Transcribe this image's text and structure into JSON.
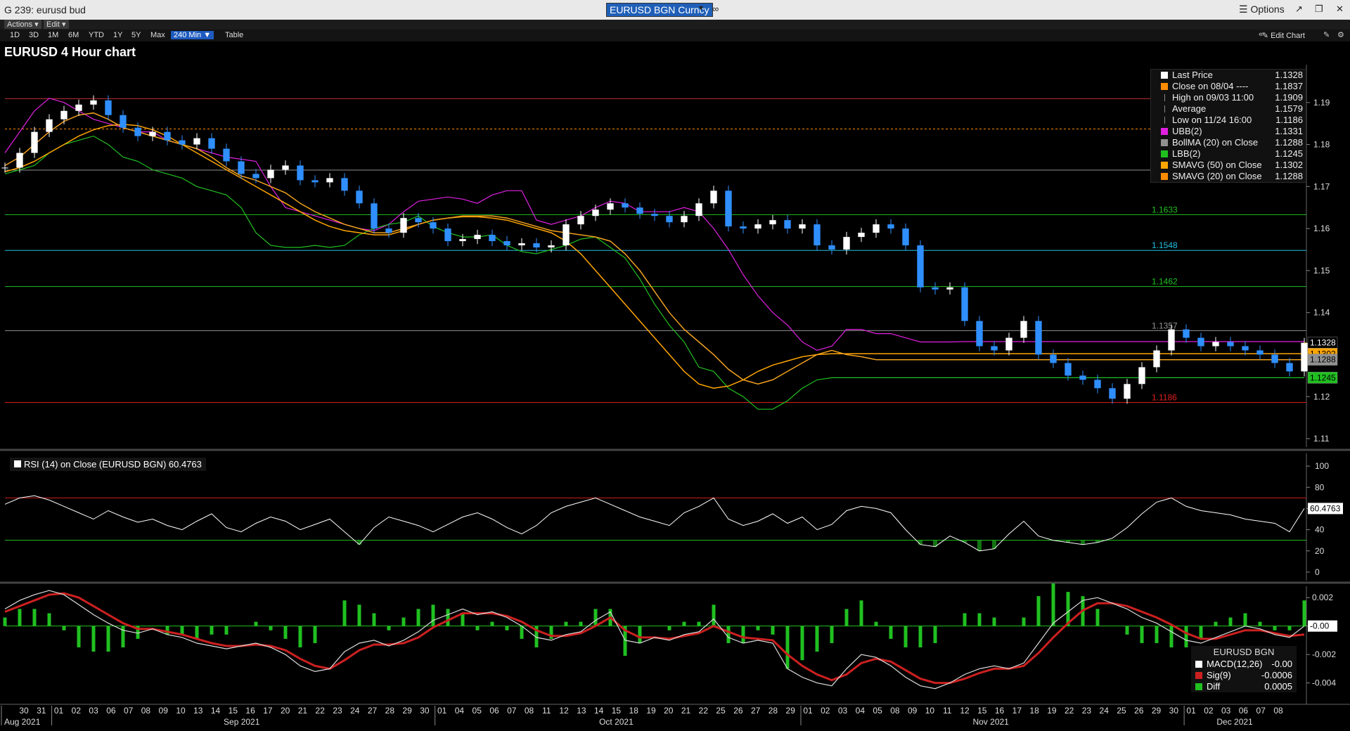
{
  "window": {
    "title": "G 239: eurusd bud",
    "ticker": "EURUSD BGN Curncy",
    "options_label": "Options"
  },
  "menu": {
    "actions": "Actions ▾",
    "edit": "Edit ▾"
  },
  "toolbar": {
    "periods": [
      "1D",
      "3D",
      "1M",
      "6M",
      "YTD",
      "1Y",
      "5Y",
      "Max"
    ],
    "interval": "240 Min ▼",
    "table": "Table",
    "edit_chart": "Edit Chart"
  },
  "chart_title": "EURUSD 4 Hour chart",
  "colors": {
    "price_up": "#ffffff",
    "price_down": "#2f8fff",
    "ubb": "#e020e0",
    "bollma": "#f0a020",
    "lbb": "#20c020",
    "sma50": "#ffa500",
    "rsi_line": "#ffffff",
    "rsi_high": "#cc2020",
    "rsi_low": "#20c020",
    "macd_hist": "#20c020",
    "sig": "#cc2020"
  },
  "legend": [
    {
      "label": "Last Price",
      "value": "1.1328",
      "color": "#ffffff"
    },
    {
      "label": "Close on 08/04 ----",
      "value": "1.1837",
      "color": "#ff8c00"
    },
    {
      "label": "High on 09/03 11:00",
      "value": "1.1909",
      "color": ""
    },
    {
      "label": "Average",
      "value": "1.1579",
      "color": ""
    },
    {
      "label": "Low on 11/24 16:00",
      "value": "1.1186",
      "color": ""
    },
    {
      "label": "UBB(2)",
      "value": "1.1331",
      "color": "#e020e0"
    },
    {
      "label": "BollMA (20)  on Close",
      "value": "1.1288",
      "color": "#909090"
    },
    {
      "label": "LBB(2)",
      "value": "1.1245",
      "color": "#20c020"
    },
    {
      "label": "SMAVG (50)  on Close",
      "value": "1.1302",
      "color": "#ffa500"
    },
    {
      "label": "SMAVG (20)  on Close",
      "value": "1.1288",
      "color": "#ff8c00"
    }
  ],
  "rsi_label": "RSI (14)  on Close (EURUSD BGN) 60.4763",
  "macd_legend": {
    "title": "EURUSD BGN",
    "rows": [
      {
        "label": "MACD(12,26)",
        "value": "-0.00",
        "color": "#ffffff"
      },
      {
        "label": "Sig(9)",
        "value": "-0.0006",
        "color": "#cc2020"
      },
      {
        "label": "Diff",
        "value": "0.0005",
        "color": "#20c020"
      }
    ]
  },
  "chart_data": {
    "type": "line",
    "price_panel": {
      "y_ticks": [
        "1.19",
        "1.18",
        "1.17",
        "1.16",
        "1.15",
        "1.14",
        "1.13",
        "1.12",
        "1.11"
      ],
      "ylim": [
        1.108,
        1.199
      ],
      "hlines": [
        {
          "value": 1.1909,
          "label": "",
          "color": "#c03030"
        },
        {
          "value": 1.1837,
          "label": "",
          "color": "#ff8c00",
          "dashed": true
        },
        {
          "value": 1.1739,
          "label": "",
          "color": "#909090"
        },
        {
          "value": 1.1633,
          "label": "1.1633",
          "color": "#20c020"
        },
        {
          "value": 1.1548,
          "label": "1.1548",
          "color": "#20c0e0"
        },
        {
          "value": 1.1462,
          "label": "1.1462",
          "color": "#20c020"
        },
        {
          "value": 1.1357,
          "label": "1.1357",
          "color": "#909090"
        },
        {
          "value": 1.1186,
          "label": "1.1186",
          "color": "#e02020"
        }
      ],
      "tags": [
        {
          "value": 1.1328,
          "text": "1.1328",
          "bg": "#000000",
          "fg": "#ffffff"
        },
        {
          "value": 1.1302,
          "text": "1.1302",
          "bg": "#ffa500",
          "fg": "#000000"
        },
        {
          "value": 1.1288,
          "text": "1.1288",
          "bg": "#909090",
          "fg": "#000000"
        },
        {
          "value": 1.1245,
          "text": "1.1245",
          "bg": "#20c020",
          "fg": "#000000"
        }
      ],
      "close": [
        1.1745,
        1.178,
        1.183,
        1.186,
        1.188,
        1.1895,
        1.1905,
        1.187,
        1.184,
        1.182,
        1.183,
        1.181,
        1.18,
        1.1815,
        1.179,
        1.176,
        1.173,
        1.172,
        1.174,
        1.175,
        1.1715,
        1.171,
        1.172,
        1.169,
        1.166,
        1.16,
        1.159,
        1.1625,
        1.1615,
        1.16,
        1.157,
        1.1575,
        1.1585,
        1.157,
        1.156,
        1.1565,
        1.1555,
        1.156,
        1.161,
        1.163,
        1.1645,
        1.166,
        1.165,
        1.1635,
        1.163,
        1.1615,
        1.163,
        1.166,
        1.169,
        1.1605,
        1.16,
        1.161,
        1.162,
        1.16,
        1.161,
        1.156,
        1.155,
        1.158,
        1.159,
        1.161,
        1.16,
        1.156,
        1.146,
        1.1455,
        1.146,
        1.138,
        1.132,
        1.131,
        1.134,
        1.138,
        1.13,
        1.128,
        1.125,
        1.124,
        1.122,
        1.1195,
        1.123,
        1.127,
        1.131,
        1.136,
        1.134,
        1.132,
        1.133,
        1.132,
        1.131,
        1.13,
        1.128,
        1.126,
        1.1328
      ],
      "ubb": [
        1.178,
        1.183,
        1.188,
        1.191,
        1.19,
        1.188,
        1.186,
        1.185,
        1.184,
        1.183,
        1.183,
        1.181,
        1.18,
        1.179,
        1.178,
        1.177,
        1.1765,
        1.176,
        1.17,
        1.165,
        1.164,
        1.163,
        1.162,
        1.161,
        1.16,
        1.1595,
        1.161,
        1.164,
        1.1665,
        1.167,
        1.1675,
        1.167,
        1.166,
        1.168,
        1.169,
        1.169,
        1.162,
        1.161,
        1.162,
        1.163,
        1.165,
        1.1665,
        1.166,
        1.164,
        1.164,
        1.164,
        1.165,
        1.164,
        1.16,
        1.155,
        1.149,
        1.144,
        1.14,
        1.137,
        1.133,
        1.131,
        1.132,
        1.136,
        1.136,
        1.135,
        1.135,
        1.134,
        1.133,
        1.133,
        1.133,
        1.1331,
        1.1331,
        1.1331,
        1.1331,
        1.1331,
        1.1331,
        1.1331,
        1.1331,
        1.1331,
        1.1331,
        1.1331,
        1.1331,
        1.1331,
        1.1331,
        1.1331,
        1.1331,
        1.1331,
        1.1331,
        1.1331,
        1.1331,
        1.1331,
        1.1331,
        1.1331,
        1.1331
      ],
      "lbb": [
        1.173,
        1.174,
        1.175,
        1.178,
        1.18,
        1.181,
        1.182,
        1.18,
        1.177,
        1.176,
        1.174,
        1.173,
        1.172,
        1.17,
        1.169,
        1.168,
        1.165,
        1.159,
        1.156,
        1.1555,
        1.1555,
        1.156,
        1.1555,
        1.156,
        1.1585,
        1.16,
        1.161,
        1.1615,
        1.163,
        1.1605,
        1.159,
        1.158,
        1.158,
        1.1585,
        1.156,
        1.1545,
        1.154,
        1.155,
        1.156,
        1.1575,
        1.158,
        1.1555,
        1.153,
        1.148,
        1.142,
        1.137,
        1.133,
        1.127,
        1.126,
        1.122,
        1.12,
        1.117,
        1.117,
        1.119,
        1.122,
        1.124,
        1.1245,
        1.1245,
        1.1245,
        1.1245,
        1.1245,
        1.1245,
        1.1245,
        1.1245,
        1.1245,
        1.1245,
        1.1245,
        1.1245,
        1.1245,
        1.1245,
        1.1245,
        1.1245,
        1.1245,
        1.1245,
        1.1245,
        1.1245,
        1.1245,
        1.1245,
        1.1245,
        1.1245,
        1.1245,
        1.1245,
        1.1245,
        1.1245,
        1.1245,
        1.1245,
        1.1245,
        1.1245,
        1.1245
      ],
      "sma20": [
        1.175,
        1.177,
        1.18,
        1.183,
        1.1855,
        1.187,
        1.1875,
        1.186,
        1.184,
        1.183,
        1.182,
        1.181,
        1.18,
        1.179,
        1.177,
        1.1745,
        1.1725,
        1.1715,
        1.17,
        1.1685,
        1.166,
        1.164,
        1.1625,
        1.161,
        1.16,
        1.159,
        1.159,
        1.16,
        1.161,
        1.162,
        1.1625,
        1.163,
        1.163,
        1.163,
        1.1625,
        1.1615,
        1.1605,
        1.1595,
        1.159,
        1.1585,
        1.158,
        1.157,
        1.154,
        1.15,
        1.145,
        1.14,
        1.136,
        1.133,
        1.13,
        1.1265,
        1.124,
        1.123,
        1.124,
        1.126,
        1.128,
        1.13,
        1.131,
        1.13,
        1.1295,
        1.1288,
        1.1288,
        1.1288,
        1.1288,
        1.1288,
        1.1288,
        1.1288,
        1.1288,
        1.1288,
        1.1288,
        1.1288,
        1.1288,
        1.1288,
        1.1288,
        1.1288,
        1.1288,
        1.1288,
        1.1288,
        1.1288,
        1.1288,
        1.1288,
        1.1288,
        1.1288,
        1.1288,
        1.1288,
        1.1288,
        1.1288,
        1.1288,
        1.1288,
        1.1288
      ],
      "sma50": [
        1.1735,
        1.1745,
        1.176,
        1.178,
        1.18,
        1.182,
        1.1835,
        1.1845,
        1.1848,
        1.1845,
        1.1835,
        1.182,
        1.18,
        1.178,
        1.176,
        1.174,
        1.172,
        1.17,
        1.168,
        1.166,
        1.164,
        1.162,
        1.1605,
        1.1595,
        1.159,
        1.1585,
        1.1585,
        1.1595,
        1.161,
        1.162,
        1.1625,
        1.1628,
        1.1628,
        1.1625,
        1.162,
        1.161,
        1.16,
        1.159,
        1.157,
        1.154,
        1.15,
        1.146,
        1.142,
        1.138,
        1.134,
        1.13,
        1.126,
        1.123,
        1.122,
        1.1225,
        1.124,
        1.126,
        1.1275,
        1.1285,
        1.1295,
        1.13,
        1.1302,
        1.1302,
        1.1302,
        1.1302,
        1.1302,
        1.1302,
        1.1302,
        1.1302,
        1.1302,
        1.1302,
        1.1302,
        1.1302,
        1.1302,
        1.1302,
        1.1302,
        1.1302,
        1.1302,
        1.1302,
        1.1302,
        1.1302,
        1.1302,
        1.1302,
        1.1302,
        1.1302,
        1.1302,
        1.1302,
        1.1302,
        1.1302,
        1.1302,
        1.1302,
        1.1302,
        1.1302,
        1.1302
      ]
    },
    "rsi_panel": {
      "name": "RSI (14)",
      "y_ticks": [
        "100",
        "80",
        "60",
        "40",
        "20",
        "0"
      ],
      "ylim": [
        -8,
        112
      ],
      "levels": [
        70,
        30
      ],
      "last": "60.4763",
      "values": [
        64,
        70,
        72,
        68,
        62,
        56,
        50,
        58,
        52,
        47,
        50,
        44,
        40,
        48,
        55,
        42,
        38,
        46,
        52,
        48,
        40,
        45,
        50,
        38,
        26,
        42,
        52,
        48,
        44,
        38,
        45,
        52,
        56,
        50,
        42,
        36,
        44,
        56,
        62,
        66,
        70,
        64,
        58,
        52,
        48,
        44,
        56,
        62,
        70,
        50,
        44,
        48,
        55,
        46,
        52,
        40,
        45,
        58,
        62,
        60,
        56,
        40,
        26,
        24,
        34,
        28,
        20,
        22,
        36,
        48,
        34,
        30,
        28,
        26,
        28,
        32,
        42,
        55,
        66,
        70,
        62,
        58,
        56,
        54,
        50,
        48,
        46,
        38,
        60
      ]
    },
    "macd_panel": {
      "y_ticks": [
        "0.002",
        "0.000",
        "-0.002",
        "-0.004"
      ],
      "ylim": [
        -0.0055,
        0.0028
      ],
      "current_tag": "-0.00",
      "macd": [
        0.0012,
        0.0018,
        0.0022,
        0.0025,
        0.0022,
        0.0015,
        0.0008,
        0.0002,
        -0.0003,
        -0.0005,
        -0.0002,
        -0.0006,
        -0.0008,
        -0.0012,
        -0.0014,
        -0.0016,
        -0.0014,
        -0.0012,
        -0.0015,
        -0.002,
        -0.0028,
        -0.0032,
        -0.003,
        -0.0018,
        -0.0012,
        -0.001,
        -0.0014,
        -0.001,
        -0.0004,
        0.0004,
        0.0008,
        0.0012,
        0.0008,
        0.001,
        0.0006,
        0.0,
        -0.0008,
        -0.001,
        -0.0006,
        -0.0004,
        0.0004,
        0.001,
        -0.001,
        -0.0012,
        -0.0008,
        -0.001,
        -0.0006,
        -0.0004,
        0.0005,
        -0.0008,
        -0.0012,
        -0.001,
        -0.0012,
        -0.003,
        -0.0036,
        -0.004,
        -0.0042,
        -0.003,
        -0.002,
        -0.0022,
        -0.0028,
        -0.0036,
        -0.0042,
        -0.0044,
        -0.004,
        -0.0034,
        -0.003,
        -0.0028,
        -0.003,
        -0.0026,
        -0.0012,
        0.0002,
        0.001,
        0.0018,
        0.002,
        0.0016,
        0.0012,
        0.0006,
        0.0002,
        -0.0004,
        -0.001,
        -0.0012,
        -0.0008,
        -0.0004,
        0.0,
        -0.0002,
        -0.0006,
        -0.0008,
        0.0
      ],
      "signal": [
        0.001,
        0.0014,
        0.0018,
        0.0022,
        0.0023,
        0.002,
        0.0014,
        0.0008,
        0.0002,
        -0.0002,
        -0.0002,
        -0.0004,
        -0.0006,
        -0.0009,
        -0.0012,
        -0.0014,
        -0.0014,
        -0.0013,
        -0.0014,
        -0.0017,
        -0.0023,
        -0.0028,
        -0.003,
        -0.0024,
        -0.0017,
        -0.0013,
        -0.0013,
        -0.0012,
        -0.0008,
        -0.0001,
        0.0004,
        0.0009,
        0.0009,
        0.0009,
        0.0007,
        0.0003,
        -0.0003,
        -0.0007,
        -0.0007,
        -0.0005,
        0.0,
        0.0006,
        -0.0003,
        -0.0008,
        -0.0008,
        -0.0009,
        -0.0007,
        -0.0005,
        0.0,
        -0.0004,
        -0.0008,
        -0.0009,
        -0.001,
        -0.002,
        -0.0028,
        -0.0034,
        -0.0038,
        -0.0034,
        -0.0026,
        -0.0023,
        -0.0025,
        -0.0031,
        -0.0037,
        -0.004,
        -0.004,
        -0.0037,
        -0.0033,
        -0.003,
        -0.003,
        -0.0028,
        -0.0019,
        -0.0008,
        0.0002,
        0.0011,
        0.0016,
        0.0016,
        0.0014,
        0.001,
        0.0006,
        0.0001,
        -0.0005,
        -0.0009,
        -0.0009,
        -0.0006,
        -0.0003,
        -0.0003,
        -0.0005,
        -0.0007,
        -0.0006
      ]
    },
    "x_axis": {
      "days": [
        "30",
        "31",
        "01",
        "02",
        "03",
        "06",
        "07",
        "08",
        "09",
        "10",
        "13",
        "14",
        "15",
        "16",
        "17",
        "20",
        "21",
        "22",
        "23",
        "24",
        "27",
        "28",
        "29",
        "30",
        "01",
        "04",
        "05",
        "06",
        "07",
        "08",
        "11",
        "12",
        "13",
        "14",
        "15",
        "18",
        "19",
        "20",
        "21",
        "22",
        "25",
        "26",
        "27",
        "28",
        "29",
        "01",
        "02",
        "03",
        "04",
        "05",
        "08",
        "09",
        "10",
        "11",
        "12",
        "15",
        "16",
        "17",
        "18",
        "19",
        "22",
        "23",
        "24",
        "25",
        "26",
        "29",
        "30",
        "01",
        "02",
        "03",
        "06",
        "07",
        "08"
      ],
      "months": [
        "Aug 2021",
        "Sep 2021",
        "Oct 2021",
        "Nov 2021",
        "Dec 2021"
      ],
      "month_starts": [
        0,
        2,
        24,
        45,
        67
      ]
    }
  }
}
